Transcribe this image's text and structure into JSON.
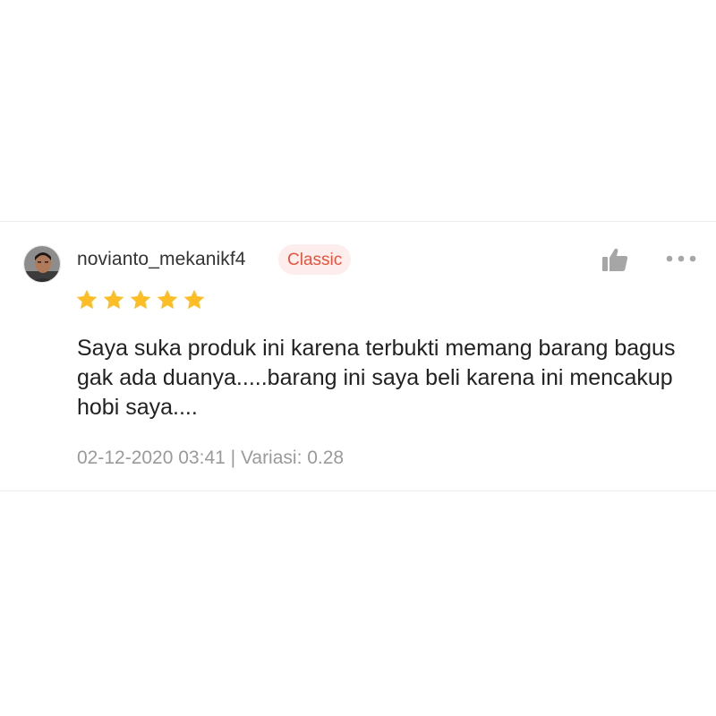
{
  "review": {
    "username": "novianto_mekanikf4",
    "badge": "Classic",
    "rating": 5,
    "rating_max": 5,
    "text": "Saya suka produk ini karena terbukti memang barang bagus gak ada duanya.....barang ini saya beli karena ini mencakup hobi saya....",
    "date": "02-12-2020 03:41",
    "separator": " | ",
    "variation_label": "Variasi: 0.28"
  },
  "icons": {
    "like": "thumbs-up-icon",
    "more": "more-horizontal-icon",
    "star": "star-icon"
  },
  "colors": {
    "star": "#fcbd25",
    "badge_text": "#e8533a",
    "badge_bg": "#fdeeed",
    "icon_gray": "#a6a6a6",
    "meta_text": "#9a9a9a"
  }
}
